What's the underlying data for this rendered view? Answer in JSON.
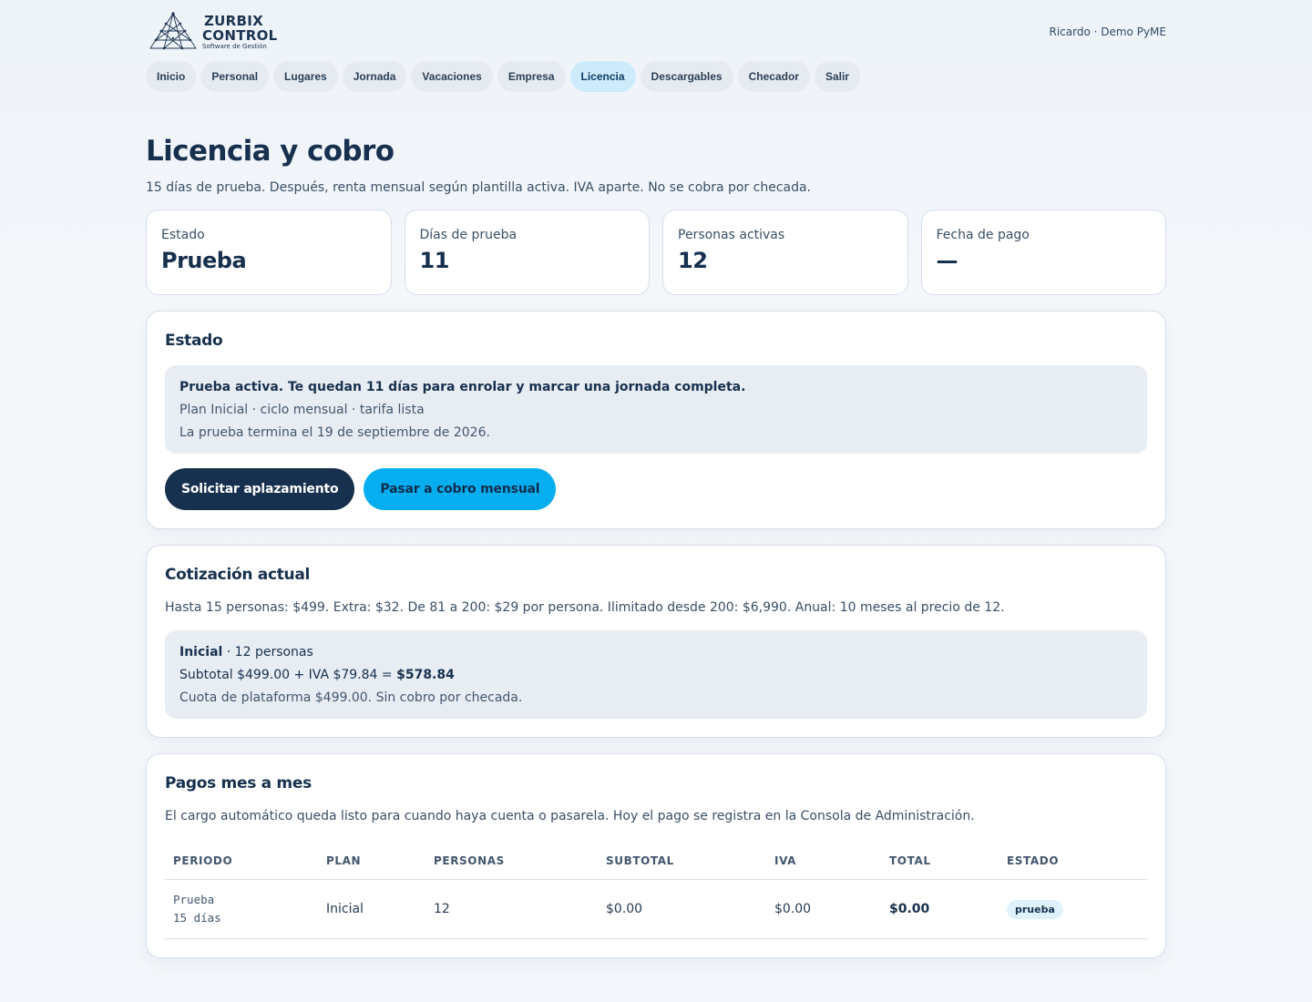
{
  "brand": {
    "line1": "ZURBIX",
    "line2": "CONTROL",
    "line3": "Software de Gestión"
  },
  "user": "Ricardo · Demo PyME",
  "nav": [
    {
      "label": "Inicio",
      "active": false
    },
    {
      "label": "Personal",
      "active": false
    },
    {
      "label": "Lugares",
      "active": false
    },
    {
      "label": "Jornada",
      "active": false
    },
    {
      "label": "Vacaciones",
      "active": false
    },
    {
      "label": "Empresa",
      "active": false
    },
    {
      "label": "Licencia",
      "active": true
    },
    {
      "label": "Descargables",
      "active": false
    },
    {
      "label": "Checador",
      "active": false
    },
    {
      "label": "Salir",
      "active": false
    }
  ],
  "page": {
    "title": "Licencia y cobro",
    "subtitle": "15 días de prueba. Después, renta mensual según plantilla activa. IVA aparte. No se cobra por checada."
  },
  "stats": [
    {
      "label": "Estado",
      "value": "Prueba"
    },
    {
      "label": "Días de prueba",
      "value": "11"
    },
    {
      "label": "Personas activas",
      "value": "12"
    },
    {
      "label": "Fecha de pago",
      "value": "—"
    }
  ],
  "estado": {
    "title": "Estado",
    "headline": "Prueba activa. Te quedan 11 días para enrolar y marcar una jornada completa.",
    "plan_line": "Plan Inicial · ciclo mensual · tarifa lista",
    "end_line": "La prueba termina el 19 de septiembre de 2026.",
    "btn_postpone": "Solicitar aplazamiento",
    "btn_monthly": "Pasar a cobro mensual"
  },
  "cotizacion": {
    "title": "Cotización actual",
    "desc": "Hasta 15 personas: $499. Extra: $32. De 81 a 200: $29 por persona. Ilimitado desde 200: $6,990. Anual: 10 meses al precio de 12.",
    "plan_name": "Inicial",
    "plan_people": " · 12 personas",
    "subtotal_text": "Subtotal $499.00 + IVA $79.84 = ",
    "total": "$578.84",
    "fee_line": "Cuota de plataforma $499.00. Sin cobro por checada."
  },
  "pagos": {
    "title": "Pagos mes a mes",
    "desc": "El cargo automático queda listo para cuando haya cuenta o pasarela. Hoy el pago se registra en la Consola de Administración.",
    "headers": [
      "PERIODO",
      "PLAN",
      "PERSONAS",
      "SUBTOTAL",
      "IVA",
      "TOTAL",
      "ESTADO"
    ],
    "rows": [
      {
        "periodo": "Prueba",
        "periodo_sub": "15 días",
        "plan": "Inicial",
        "personas": "12",
        "subtotal": "$0.00",
        "iva": "$0.00",
        "total": "$0.00",
        "estado": "prueba"
      }
    ]
  }
}
